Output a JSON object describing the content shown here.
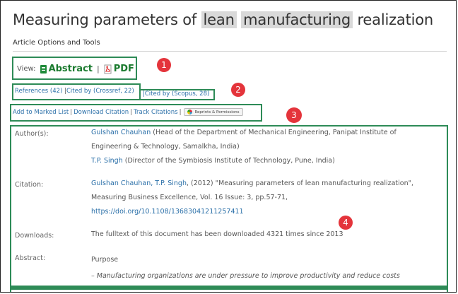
{
  "page": {
    "title_parts": [
      {
        "text": "Measuring parameters of ",
        "highlight": false
      },
      {
        "text": "lean",
        "highlight": true
      },
      {
        "text": " ",
        "highlight": false
      },
      {
        "text": "manufacturing",
        "highlight": true
      },
      {
        "text": " realization",
        "highlight": false
      }
    ],
    "article_options": "Article Options and Tools"
  },
  "view": {
    "label": "View:",
    "abstract": "Abstract",
    "divider": "|",
    "pdf": "PDF"
  },
  "references": {
    "refs": "References (42)",
    "pipe1": " |",
    "crossref": "Cited by (Crossref, 22)",
    "pipe2": " |",
    "scopus": "Cited by (Scopus, 28)"
  },
  "tools": {
    "marked": "Add to Marked List",
    "pipe1": "|",
    "download": "Download Citation",
    "pipe2": "|",
    "track": "Track Citations",
    "pipe3": "|",
    "reprints": "Reprints & Permissions"
  },
  "badges": {
    "one": "1",
    "two": "2",
    "three": "3",
    "four": "4"
  },
  "details": {
    "authors_label": "Author(s):",
    "author1_name": "Gulshan Chauhan",
    "author1_affil": " (Head of the Department of Mechanical Engineering, Panipat Institute of",
    "author1_affil2": "Engineering & Technology, Samalkha, India)",
    "author2_name": "T.P. Singh",
    "author2_affil": " (Director of the Symbiosis Institute of Technology, Pune, India)",
    "citation_label": "Citation:",
    "citation_authors": "Gulshan Chauhan, T.P. Singh",
    "citation_rest": ", (2012) \"Measuring parameters of lean manufacturing realization\",",
    "citation_line2": "Measuring Business Excellence, Vol. 16 Issue: 3, pp.57-71,",
    "citation_doi": "https://doi.org/10.1108/13683041211257411",
    "downloads_label": "Downloads:",
    "downloads_text": "The fulltext of this document has been downloaded 4321 times since 2013",
    "abstract_label": "Abstract:",
    "abstract_heading": "Purpose",
    "abstract_text": "– Manufacturing organizations are under pressure to improve productivity and reduce costs"
  },
  "colors": {
    "accent": "#2e8b57",
    "badge": "#e4343b",
    "link": "#2a6fa8"
  }
}
